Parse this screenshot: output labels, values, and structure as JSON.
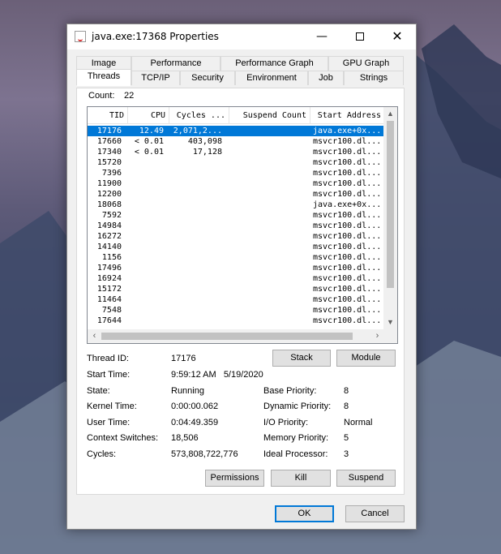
{
  "window": {
    "title": "java.exe:17368 Properties",
    "minimize_glyph": "—",
    "close_glyph": "✕"
  },
  "tabs_back": [
    "Image",
    "Performance",
    "Performance Graph",
    "GPU Graph"
  ],
  "tabs_front": [
    "Threads",
    "TCP/IP",
    "Security",
    "Environment",
    "Job",
    "Strings"
  ],
  "active_tab": "Threads",
  "count": {
    "label": "Count:",
    "value": "22"
  },
  "columns": [
    "TID",
    "CPU",
    "Cycles ...",
    "Suspend Count",
    "Start Address"
  ],
  "threads": [
    {
      "tid": "17176",
      "cpu": "12.49",
      "cycles": "2,071,2...",
      "suspend": "",
      "address": "java.exe+0x..."
    },
    {
      "tid": "17660",
      "cpu": "< 0.01",
      "cycles": "403,098",
      "suspend": "",
      "address": "msvcr100.dl..."
    },
    {
      "tid": "17340",
      "cpu": "< 0.01",
      "cycles": "17,128",
      "suspend": "",
      "address": "msvcr100.dl..."
    },
    {
      "tid": "15720",
      "cpu": "",
      "cycles": "",
      "suspend": "",
      "address": "msvcr100.dl..."
    },
    {
      "tid": "7396",
      "cpu": "",
      "cycles": "",
      "suspend": "",
      "address": "msvcr100.dl..."
    },
    {
      "tid": "11900",
      "cpu": "",
      "cycles": "",
      "suspend": "",
      "address": "msvcr100.dl..."
    },
    {
      "tid": "12200",
      "cpu": "",
      "cycles": "",
      "suspend": "",
      "address": "msvcr100.dl..."
    },
    {
      "tid": "18068",
      "cpu": "",
      "cycles": "",
      "suspend": "",
      "address": "java.exe+0x..."
    },
    {
      "tid": "7592",
      "cpu": "",
      "cycles": "",
      "suspend": "",
      "address": "msvcr100.dl..."
    },
    {
      "tid": "14984",
      "cpu": "",
      "cycles": "",
      "suspend": "",
      "address": "msvcr100.dl..."
    },
    {
      "tid": "16272",
      "cpu": "",
      "cycles": "",
      "suspend": "",
      "address": "msvcr100.dl..."
    },
    {
      "tid": "14140",
      "cpu": "",
      "cycles": "",
      "suspend": "",
      "address": "msvcr100.dl..."
    },
    {
      "tid": "1156",
      "cpu": "",
      "cycles": "",
      "suspend": "",
      "address": "msvcr100.dl..."
    },
    {
      "tid": "17496",
      "cpu": "",
      "cycles": "",
      "suspend": "",
      "address": "msvcr100.dl..."
    },
    {
      "tid": "16924",
      "cpu": "",
      "cycles": "",
      "suspend": "",
      "address": "msvcr100.dl..."
    },
    {
      "tid": "15172",
      "cpu": "",
      "cycles": "",
      "suspend": "",
      "address": "msvcr100.dl..."
    },
    {
      "tid": "11464",
      "cpu": "",
      "cycles": "",
      "suspend": "",
      "address": "msvcr100.dl..."
    },
    {
      "tid": "7548",
      "cpu": "",
      "cycles": "",
      "suspend": "",
      "address": "msvcr100.dl..."
    },
    {
      "tid": "17644",
      "cpu": "",
      "cycles": "",
      "suspend": "",
      "address": "msvcr100.dl..."
    }
  ],
  "selected_tid": "17176",
  "details": {
    "thread_id_label": "Thread ID:",
    "thread_id": "17176",
    "start_time_label": "Start Time:",
    "start_time": "9:59:12 AM   5/19/2020",
    "state_label": "State:",
    "state": "Running",
    "kernel_time_label": "Kernel Time:",
    "kernel_time": "0:00:00.062",
    "user_time_label": "User Time:",
    "user_time": "0:04:49.359",
    "context_switches_label": "Context Switches:",
    "context_switches": "18,506",
    "cycles_label": "Cycles:",
    "cycles": "573,808,722,776",
    "base_priority_label": "Base Priority:",
    "base_priority": "8",
    "dynamic_priority_label": "Dynamic Priority:",
    "dynamic_priority": "8",
    "io_priority_label": "I/O Priority:",
    "io_priority": "Normal",
    "memory_priority_label": "Memory Priority:",
    "memory_priority": "5",
    "ideal_processor_label": "Ideal Processor:",
    "ideal_processor": "3"
  },
  "buttons": {
    "stack": "Stack",
    "module": "Module",
    "permissions": "Permissions",
    "kill": "Kill",
    "suspend": "Suspend",
    "ok": "OK",
    "cancel": "Cancel"
  },
  "colors": {
    "selection": "#0078d7",
    "window_bg": "#f0f0f0"
  }
}
